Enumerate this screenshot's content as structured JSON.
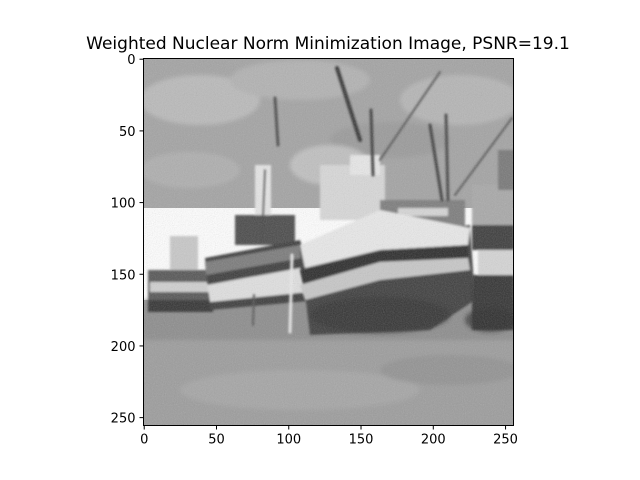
{
  "figure": {
    "title": "Weighted Nuclear Norm Minimization Image, PSNR=19.1",
    "image_size": [
      256,
      256
    ],
    "x_ticks": [
      0,
      50,
      100,
      150,
      200,
      250
    ],
    "y_ticks": [
      0,
      50,
      100,
      150,
      200,
      250
    ],
    "axis_color": "#000000",
    "background": "#ffffff",
    "colormap": "gray"
  }
}
